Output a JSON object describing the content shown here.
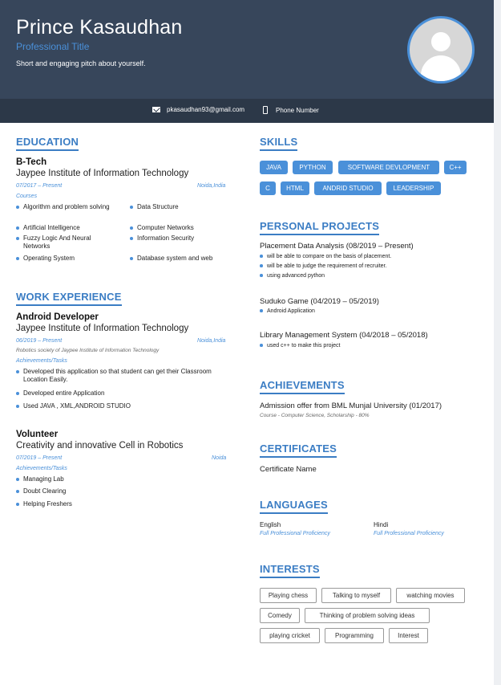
{
  "header": {
    "name": "Prince Kasaudhan",
    "professional_title": "Professional Title",
    "pitch": "Short and engaging pitch about yourself.",
    "email": "pkasaudhan93@gmail.com",
    "phone": "Phone Number"
  },
  "sections": {
    "education": "EDUCATION",
    "work": "WORK EXPERIENCE",
    "skills": "SKILLS",
    "projects": "PERSONAL PROJECTS",
    "achievements": "ACHIEVEMENTS",
    "certificates": "CERTIFICATES",
    "languages": "LANGUAGES",
    "interests": "INTERESTS"
  },
  "education": {
    "degree": "B-Tech",
    "institute": "Jaypee Institute of Information Technology",
    "dates": "07/2017 – Present",
    "location": "Noida,India",
    "courses_label": "Courses",
    "courses": [
      "Algorithm and problem solving",
      "Data Structure",
      "Artificial Intelligence",
      "Computer Networks",
      "Fuzzy Logic And Neural Networks",
      "Information Security",
      "Operating System",
      "Database system and web"
    ]
  },
  "work": [
    {
      "role": "Android Developer",
      "org": "Jaypee Institute of Information Technology",
      "dates": "06/2019 – Present",
      "location": "Noida,India",
      "desc": "Robotics society of Jaypee Institute of Information Technology",
      "tasks_label": "Achievements/Tasks",
      "tasks": [
        "Developed this application so that student can get their Classroom Location Easily.",
        "Developed entire Application",
        "Used JAVA , XML,ANDROID STUDIO"
      ]
    },
    {
      "role": "Volunteer",
      "org": "Creativity and innovative Cell in Robotics",
      "dates": "07/2019 – Present",
      "location": "Noida",
      "tasks_label": "Achievements/Tasks",
      "tasks": [
        "Managing Lab",
        "Doubt Clearing",
        "Helping Freshers"
      ]
    }
  ],
  "skills": [
    "JAVA",
    "PYTHON",
    "SOFTWARE DEVLOPMENT",
    "C++",
    "C",
    "HTML",
    "ANDRID STUDIO",
    "LEADERSHIP"
  ],
  "projects": [
    {
      "title": "Placement Data Analysis (08/2019 – Present)",
      "items": [
        "will be able to compare on the basis of placement.",
        "will be able to judge the requirement of recruiter.",
        "using advanced python"
      ]
    },
    {
      "title": "Suduko Game (04/2019 – 05/2019)",
      "items": [
        "Android Application"
      ]
    },
    {
      "title": "Library Management System (04/2018 – 05/2018)",
      "items": [
        "used c++ to make this project"
      ]
    }
  ],
  "achievement": {
    "title": "Admission offer from BML Munjal University (01/2017)",
    "detail": "Course - Computer Science, Scholarship - 80%"
  },
  "certificate": "Certificate Name",
  "languages": [
    {
      "name": "English",
      "level": "Full Professional Proficiency"
    },
    {
      "name": "Hindi",
      "level": "Full Professional Proficiency"
    }
  ],
  "interests": [
    "Playing chess",
    "Talking to myself",
    "watching movies",
    "Comedy",
    "Thinking of problem solving ideas",
    "playing cricket",
    "Programming",
    "Interest"
  ],
  "colors": {
    "header": "#37465b",
    "contact_bar": "#2c3848",
    "accent": "#4a90d9",
    "section_title": "#3b7dc4"
  }
}
